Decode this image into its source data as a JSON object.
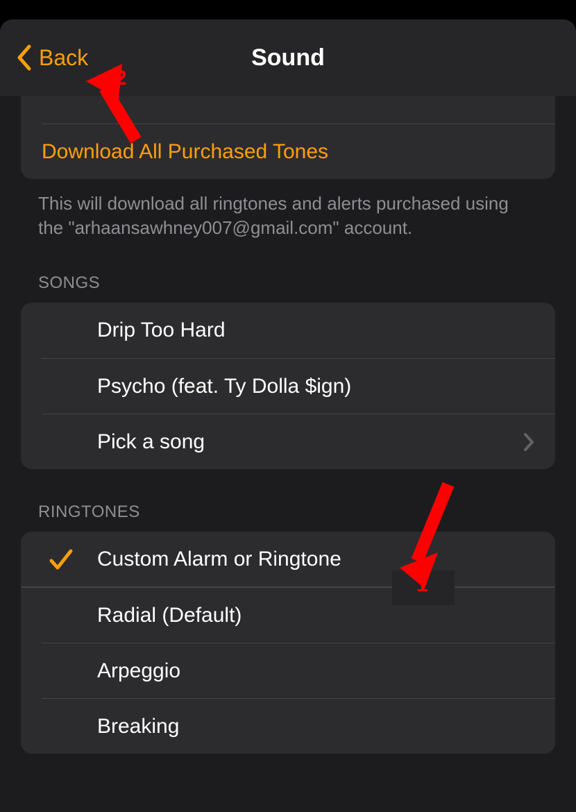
{
  "nav": {
    "back_label": "Back",
    "title": "Sound"
  },
  "store": {
    "download_label": "Download All Purchased Tones",
    "footer": "This will download all ringtones and alerts purchased using the \"arhaansawhney007@gmail.com\" account."
  },
  "songs": {
    "header": "SONGS",
    "items": [
      {
        "label": "Drip Too Hard"
      },
      {
        "label": "Psycho (feat. Ty Dolla $ign)"
      }
    ],
    "pick_label": "Pick a song"
  },
  "ringtones": {
    "header": "RINGTONES",
    "selected_label": "Custom Alarm or Ringtone",
    "items": [
      {
        "label": "Radial (Default)"
      },
      {
        "label": "Arpeggio"
      },
      {
        "label": "Breaking"
      }
    ]
  },
  "annotations": {
    "arrow_color": "#ff0000",
    "num1": "1",
    "num2": "2"
  }
}
